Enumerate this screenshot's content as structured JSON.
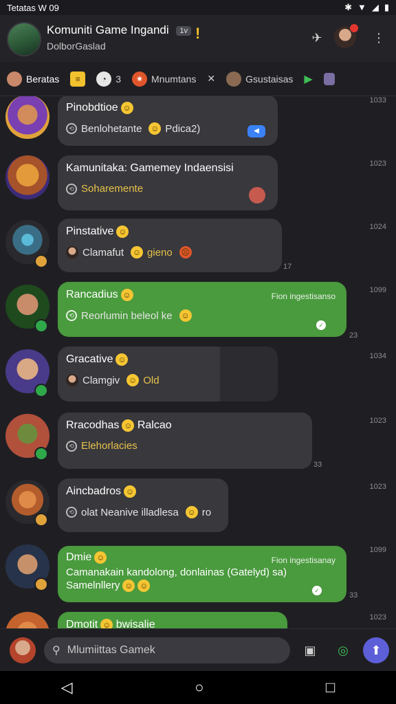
{
  "status_bar": {
    "time": "Tetatas W 09",
    "icons": [
      "bluetooth-icon",
      "wifi-icon",
      "signal-icon",
      "battery-icon"
    ]
  },
  "header": {
    "title": "Komuniti Game Ingandi",
    "badge": "1v",
    "subtitle": "DolborGaslad"
  },
  "tabs": [
    {
      "label": "Beratas",
      "icon": "avatar"
    },
    {
      "label": "",
      "icon": "note"
    },
    {
      "label": "3",
      "icon": "clock"
    },
    {
      "label": "Mnumtans",
      "icon": "burst"
    },
    {
      "label": "",
      "icon": "crossed-swords"
    },
    {
      "label": "Gsustaisas",
      "icon": "avatar"
    }
  ],
  "messages": [
    {
      "name": "Pinobdtioe",
      "text": "Benlohetante",
      "text2": "Pdica2)",
      "time": "1033",
      "style": "gray",
      "avatar": [
        "#7a3fb0",
        "#e0a23a"
      ],
      "online": false
    },
    {
      "name": "Kamunitaka: Gamemey Indaensisi",
      "text": "Soharemente",
      "text2": "",
      "time": "1023",
      "style": "gray-yellow",
      "avatar": [
        "#a6522a",
        "#3d2b7a"
      ],
      "online": false
    },
    {
      "name": "Pinstative",
      "text": "Clamafut",
      "text2": "gieno",
      "time": "1024",
      "style": "gray",
      "avatar": [
        "#3a6e86",
        "#2a2a2e"
      ],
      "online": false,
      "count": "17"
    },
    {
      "name": "Rancadius",
      "text": "Reorlumin beleol ke",
      "text2": "",
      "time": "1099",
      "style": "green",
      "meta": "Fion ingestisanso",
      "avatar": [
        "#c98c6a",
        "#1e4a1e"
      ],
      "online": true,
      "count": "23"
    },
    {
      "name": "Gracative",
      "text": "Clamgiv",
      "text2": "Old",
      "time": "1034",
      "style": "gray",
      "avatar": [
        "#d9a884",
        "#4a3a8a"
      ],
      "online": true
    },
    {
      "name": "Rracodhas",
      "name2": "Ralcao",
      "text": "Elehorlacies",
      "text2": "",
      "time": "1023",
      "style": "gray-yellow",
      "avatar": [
        "#6e8b3d",
        "#b1503b"
      ],
      "online": true,
      "count": "33"
    },
    {
      "name": "Aincbadros",
      "text": "olat Neanive illadlesa",
      "text2": "ro",
      "time": "1023",
      "style": "gray",
      "avatar": [
        "#b35c2c",
        "#2a2a2e"
      ],
      "online": false
    },
    {
      "name": "Dmie",
      "text": "Camanakain kandolong, donlainas (Gatelyd) sa)",
      "text2": "Samelnllery",
      "time": "1099",
      "style": "green",
      "meta": "Fion ingestisanay",
      "avatar": [
        "#8a5a3a",
        "#27334a"
      ],
      "online": false,
      "count": "33"
    },
    {
      "name": "Dmotit",
      "name2": "bwisalie",
      "text": "",
      "text2": "",
      "time": "1023",
      "style": "green",
      "avatar": [
        "#c4632e",
        "#2a2a2e"
      ],
      "online": false
    }
  ],
  "composer": {
    "placeholder": "Mlumiittas Gamek"
  },
  "colors": {
    "green_bubble": "#4a9a3e",
    "gray_bubble": "#38383d",
    "accent": "#5d5fd8"
  }
}
